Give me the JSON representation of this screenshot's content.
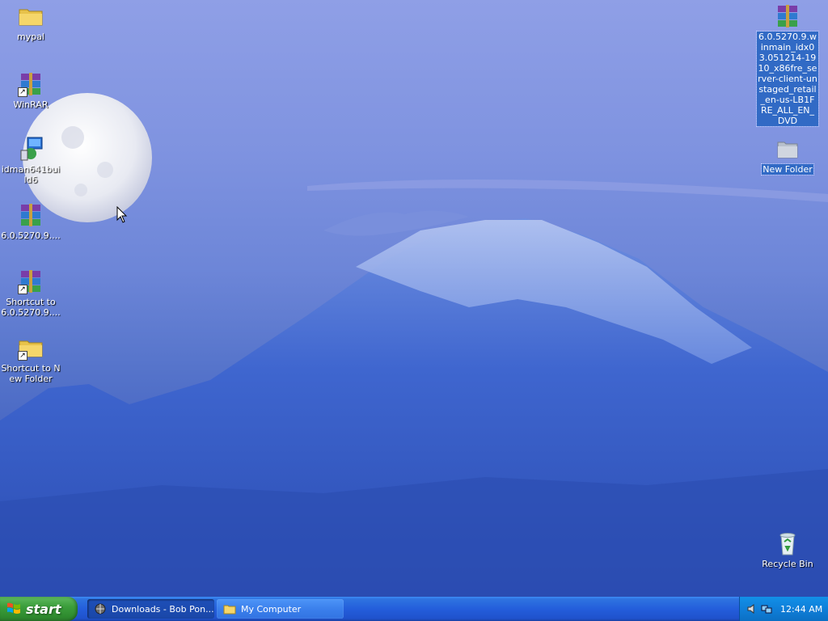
{
  "desktop": {
    "icons": [
      {
        "label": "mypal",
        "type": "folder-icon"
      },
      {
        "label": "WinRAR",
        "type": "winrar-shortcut-icon"
      },
      {
        "label": "idman641build6",
        "type": "installer-icon"
      },
      {
        "label": "6.0.5270.9....",
        "type": "winrar-archive-icon"
      },
      {
        "label": "Shortcut to 6.0.5270.9....",
        "type": "winrar-shortcut-icon"
      },
      {
        "label": "Shortcut to New Folder",
        "type": "folder-shortcut-icon"
      },
      {
        "label": "6.0.5270.9.winmain_idx03.051214-1910_x86fre_server-client-unstaged_retail_en-us-LB1FRE_ALL_EN_DVD",
        "type": "winrar-archive-icon"
      },
      {
        "label": "New Folder",
        "type": "folder-icon"
      },
      {
        "label": "Recycle Bin",
        "type": "recycle-bin-icon"
      }
    ]
  },
  "taskbar": {
    "start_label": "start",
    "tasks": [
      {
        "label": "Downloads - Bob Pon...",
        "icon": "browser-icon",
        "state": "active"
      },
      {
        "label": "My Computer",
        "icon": "folder-icon",
        "state": "inactive"
      }
    ],
    "tray_icons": [
      "volume-icon",
      "network-icon"
    ],
    "clock": "12:44 AM"
  },
  "colors": {
    "taskbar_blue": "#245edb",
    "start_green": "#3c9e3c",
    "tray_blue": "#0f7fd9",
    "selection_blue": "#316ac5"
  }
}
